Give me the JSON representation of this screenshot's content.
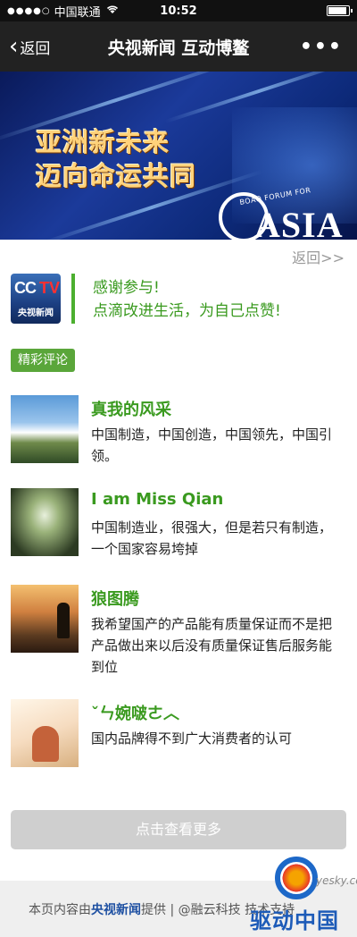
{
  "status_bar": {
    "signal": "●●●●○",
    "carrier": "中国联通",
    "wifi_icon": "wifi-icon",
    "time": "10:52",
    "battery_icon": "battery-icon"
  },
  "nav": {
    "back_label": "返回",
    "title": "央视新闻 互动博鳌",
    "more_label": "•••"
  },
  "banner": {
    "line1": "亚洲新未来",
    "line2": "迈向命运共同",
    "forum_text": "BOAO FORUM FOR",
    "asia_text": "ASIA"
  },
  "return_link": "返回>>",
  "thanks": {
    "logo_cc": "CC",
    "logo_tv": "TV",
    "logo_name": "央视新闻",
    "line1": "感谢参与!",
    "line2": "点滴改进生活，为自己点赞!"
  },
  "section_tag": "精彩评论",
  "comments": [
    {
      "name": "真我的风采",
      "text": "中国制造，中国创造，中国领先，中国引领。"
    },
    {
      "name": "I am Miss Qian",
      "text": "中国制造业，很强大，但是若只有制造，一个国家容易垮掉"
    },
    {
      "name": "狼图腾",
      "text": "我希望国产的产品能有质量保证而不是把产品做出来以后没有质量保证售后服务能到位"
    },
    {
      "name": "ˇㄣ婉啵ㄜ︿",
      "text": "国内品牌得不到广大消费者的认可"
    }
  ],
  "more_button": "点击查看更多",
  "footer": {
    "prefix": "本页内容由",
    "link": "央视新闻",
    "middle": "提供 | @融云科技 技术",
    "suffix": "支持"
  },
  "watermark": {
    "site": "yesky.com",
    "brand": "驱动中国"
  }
}
